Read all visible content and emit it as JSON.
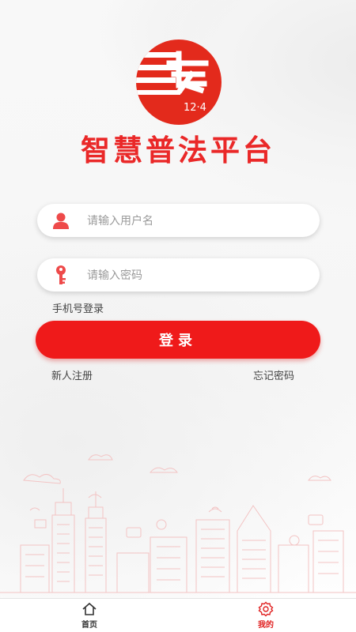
{
  "logo": {
    "text": "12·4",
    "accent": "#e32a1c"
  },
  "app_title": "智慧普法平台",
  "login": {
    "username_placeholder": "请输入用户名",
    "password_placeholder": "请输入密码",
    "phone_login_link": "手机号登录",
    "submit_label": "登录",
    "register_link": "新人注册",
    "forgot_link": "忘记密码"
  },
  "icons": {
    "username": "user-icon",
    "password": "key-icon",
    "home": "home-icon",
    "mine": "gear-icon"
  },
  "tabbar": {
    "items": [
      {
        "label": "首页",
        "active": false
      },
      {
        "label": "我的",
        "active": true
      }
    ]
  },
  "colors": {
    "primary": "#ef1a1a",
    "title": "#ea2828",
    "placeholder": "#9a9a9a",
    "tab_active": "#e02020"
  }
}
